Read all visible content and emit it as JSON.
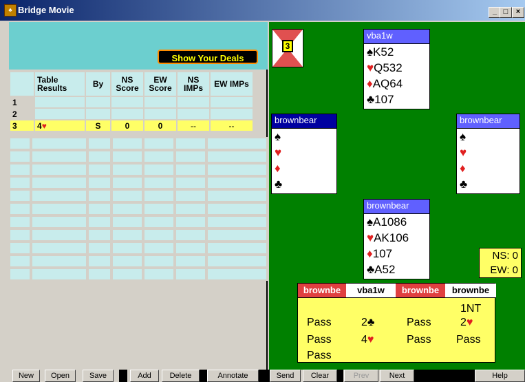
{
  "window": {
    "title": "Bridge Movie",
    "min": "_",
    "max": "□",
    "close": "×"
  },
  "left": {
    "show_deals_label": "Show Your Deals",
    "headers": [
      "Table Results",
      "By",
      "NS Score",
      "EW Score",
      "NS IMPs",
      "EW IMPs"
    ],
    "rows": [
      {
        "n": "1",
        "result": "",
        "suit": "",
        "by": "",
        "ns": "",
        "ew": "",
        "nsi": "",
        "ewi": ""
      },
      {
        "n": "2",
        "result": "",
        "suit": "",
        "by": "",
        "ns": "",
        "ew": "",
        "nsi": "",
        "ewi": ""
      },
      {
        "n": "3",
        "result": "4",
        "suit": "♥",
        "by": "S",
        "ns": "0",
        "ew": "0",
        "nsi": "--",
        "ewi": "--"
      }
    ]
  },
  "board": {
    "number": "3"
  },
  "hands": {
    "north": {
      "name": "vba1w",
      "spades": "K52",
      "hearts": "Q532",
      "diamonds": "AQ64",
      "clubs": "107"
    },
    "west": {
      "name": "brownbear",
      "spades": "",
      "hearts": "",
      "diamonds": "",
      "clubs": ""
    },
    "east": {
      "name": "brownbear",
      "spades": "",
      "hearts": "",
      "diamonds": "",
      "clubs": ""
    },
    "south": {
      "name": "brownbear",
      "spades": "A1086",
      "hearts": "AK106",
      "diamonds": "107",
      "clubs": "A52"
    }
  },
  "suits": {
    "spade": "♠",
    "heart": "♥",
    "diamond": "♦",
    "club": "♣"
  },
  "score": {
    "ns": "NS: 0",
    "ew": "EW: 0"
  },
  "bidding": {
    "headers": [
      "brownbe",
      "vba1w",
      "brownbe",
      "brownbe"
    ],
    "bids": [
      {
        "text": "1NT",
        "suit": ""
      },
      {
        "text": "Pass",
        "suit": ""
      },
      {
        "text": "2",
        "suit": "♣"
      },
      {
        "text": "Pass",
        "suit": ""
      },
      {
        "text": "2",
        "suit": "♥"
      },
      {
        "text": "Pass",
        "suit": ""
      },
      {
        "text": "4",
        "suit": "♥"
      },
      {
        "text": "Pass",
        "suit": ""
      },
      {
        "text": "Pass",
        "suit": ""
      },
      {
        "text": "Pass",
        "suit": ""
      }
    ]
  },
  "buttons": {
    "new": "New",
    "open": "Open",
    "save": "Save",
    "add": "Add",
    "delete": "Delete",
    "annotate": "Annotate",
    "send": "Send",
    "clear": "Clear",
    "prev": "Prev",
    "next": "Next",
    "help": "Help"
  },
  "colors": {
    "green": "#008000",
    "teal": "#6ccfcf",
    "highlight": "#ffff66",
    "red_suit": "#e02020"
  }
}
